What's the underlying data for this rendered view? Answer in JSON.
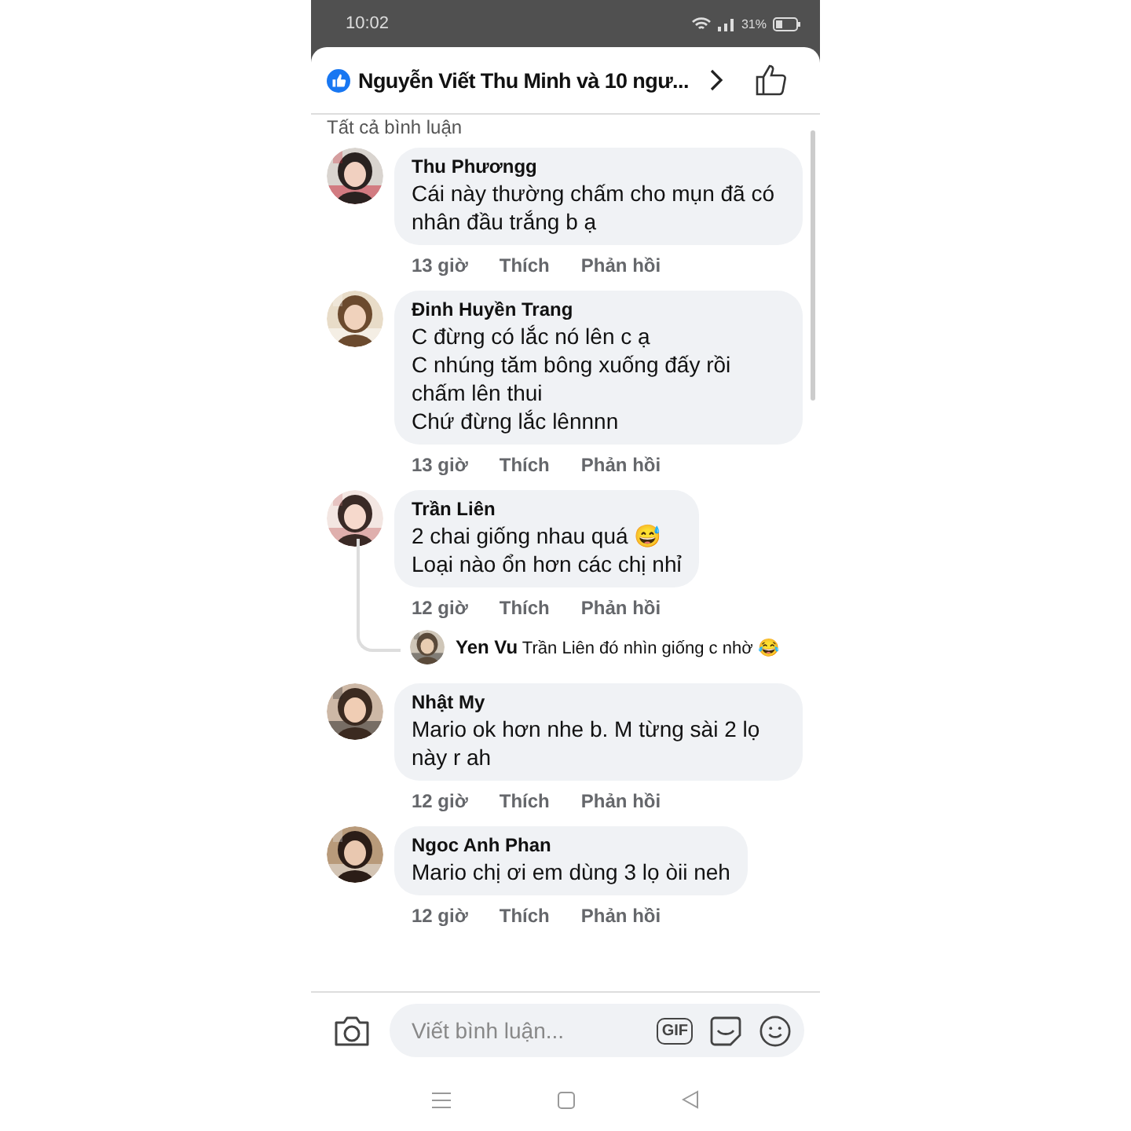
{
  "status_bar": {
    "time": "10:02",
    "battery": "31%"
  },
  "header": {
    "title": "Nguyễn Viết Thu Minh và 10 ngư...",
    "section_label": "Tất cả bình luận"
  },
  "comments": [
    {
      "name": "Thu Phươngg",
      "text": "Cái này thường chấm cho mụn đã có nhân đầu trắng b ạ",
      "time": "13 giờ",
      "like": "Thích",
      "reply": "Phản hồi"
    },
    {
      "name": "Đinh Huyền Trang",
      "text": "C đừng có lắc nó lên c ạ\nC nhúng tăm bông xuống đấy rồi chấm lên thui\nChứ đừng lắc lênnnn",
      "time": "13 giờ",
      "like": "Thích",
      "reply": "Phản hồi"
    },
    {
      "name": "Trần Liên",
      "text": "2 chai giống nhau quá 😅\nLoại nào ổn hơn các chị nhỉ",
      "time": "12 giờ",
      "like": "Thích",
      "reply": "Phản hồi",
      "replies": [
        {
          "name": "Yen Vu",
          "text": "Trần Liên đó nhìn giống c nhờ 😂"
        }
      ]
    },
    {
      "name": "Nhật My",
      "text": "Mario ok hơn nhe b. M từng sài 2 lọ này r ah",
      "time": "12 giờ",
      "like": "Thích",
      "reply": "Phản hồi"
    },
    {
      "name": "Ngoc Anh Phan",
      "text": "Mario chị ơi em dùng 3 lọ òii neh",
      "time": "12 giờ",
      "like": "Thích",
      "reply": "Phản hồi"
    }
  ],
  "composer": {
    "placeholder": "Viết bình luận...",
    "gif": "GIF"
  }
}
